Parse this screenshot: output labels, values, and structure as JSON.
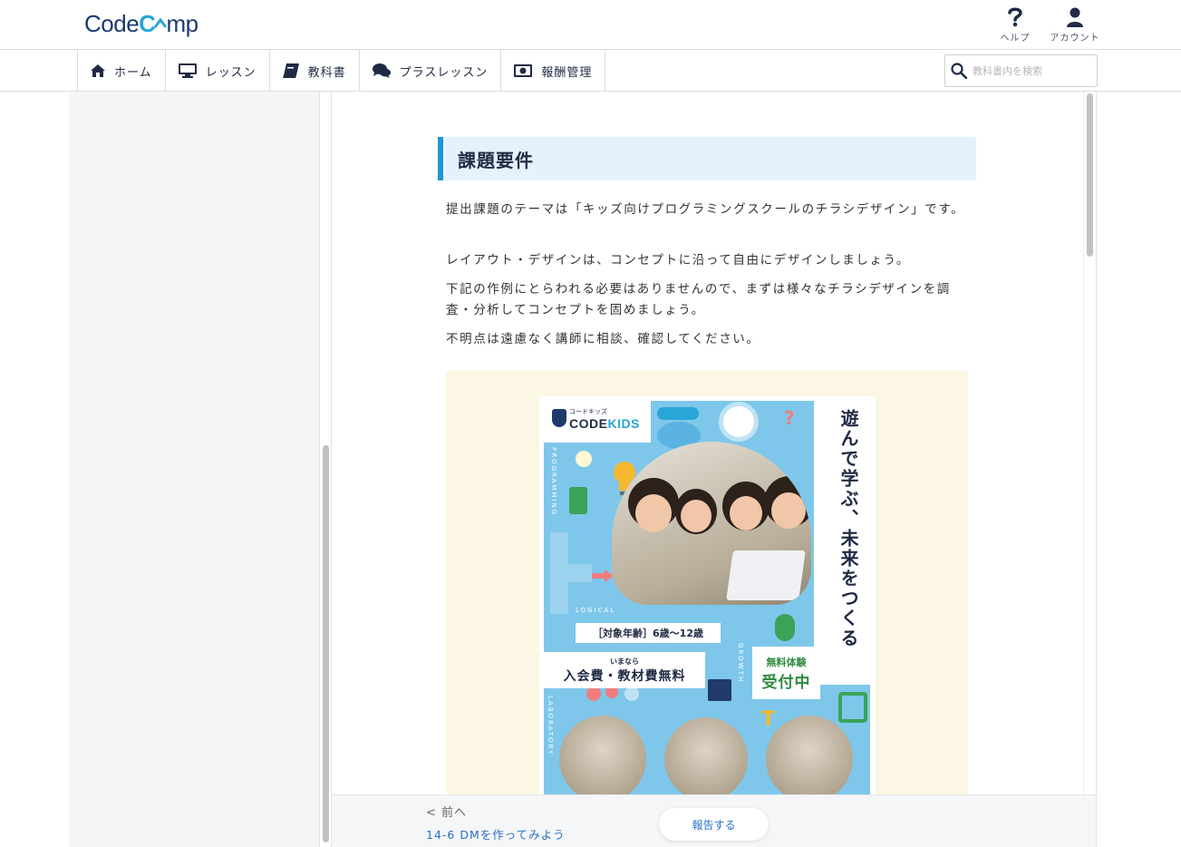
{
  "header": {
    "logo_text_a": "Code",
    "logo_text_b": "C",
    "logo_text_c": "mp",
    "help_label": "ヘルプ",
    "account_label": "アカウント",
    "brand_color": "#1c3b6e",
    "accent_color": "#2aa5d8"
  },
  "nav": {
    "items": [
      {
        "label": "ホーム",
        "icon": "home-icon"
      },
      {
        "label": "レッスン",
        "icon": "monitor-icon"
      },
      {
        "label": "教科書",
        "icon": "book-icon"
      },
      {
        "label": "プラスレッスン",
        "icon": "chat-icon"
      },
      {
        "label": "報酬管理",
        "icon": "money-icon"
      }
    ],
    "search_placeholder": "教科書内を検索"
  },
  "content": {
    "heading": "課題要件",
    "paragraphs": [
      "提出課題のテーマは「キッズ向けプログラミングスクールのチラシデザイン」です。",
      "レイアウト・デザインは、コンセプトに沿って自由にデザインしましょう。",
      "下記の作例にとらわれる必要はありませんので、まずは様々なチラシデザインを調査・分析してコンセプトを固めましょう。",
      "不明点は遠慮なく講師に相談、確認してください。"
    ],
    "flyer": {
      "brand_small": "コードキッズ",
      "brand_a": "CODE",
      "brand_b": "KIDS",
      "vertical_copy": "遊んで学ぶ、未来をつくる",
      "age_text": "［対象年齢］6歳〜12歳",
      "fee_small": "いまなら",
      "fee_main": "入会費・教材費無料",
      "trial_small": "無料体験",
      "trial_main": "受付中",
      "side_programming": "PROGRAMMING",
      "side_logical": "LOGICAL",
      "side_growth": "GROWTH",
      "side_laboratory": "LABORATORY"
    }
  },
  "footer": {
    "prev_label": "< 前へ",
    "prev_link": "14-6 DMを作ってみよう",
    "report_button": "報告する"
  }
}
